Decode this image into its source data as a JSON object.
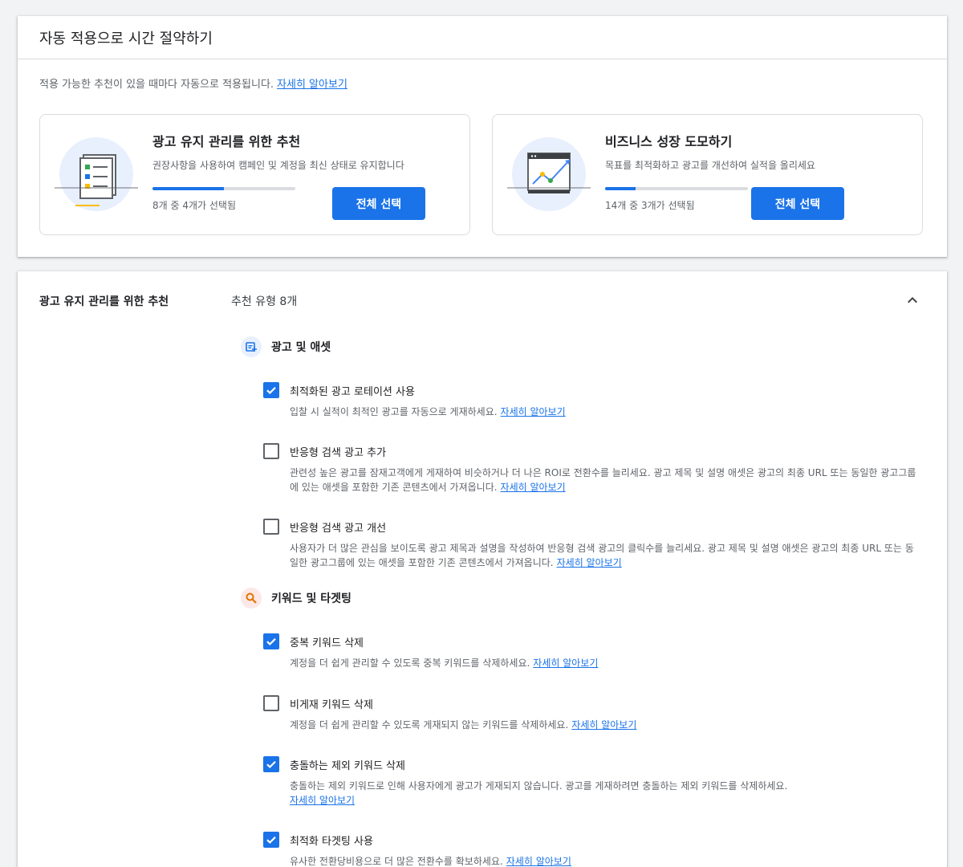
{
  "top": {
    "title": "자동 적용으로 시간 절약하기",
    "subtitle": "적용 가능한 추천이 있을 때마다 자동으로 적용됩니다.",
    "learn_more": "자세히 알아보기",
    "cards": [
      {
        "title": "광고 유지 관리를 위한 추천",
        "description": "권장사항을 사용하여 캠페인 및 계정을 최신 상태로 유지합니다",
        "progress_fraction": 0.5,
        "progress_text": "8개 중 4개가 선택됨",
        "button_label": "전체 선택",
        "icon": "checklist-illustration"
      },
      {
        "title": "비즈니스 성장 도모하기",
        "description": "목표를 최적화하고 광고를 개선하여 실적을 올리세요",
        "progress_fraction": 0.214,
        "progress_text": "14개 중 3개가 선택됨",
        "button_label": "전체 선택",
        "icon": "growth-chart-illustration"
      }
    ]
  },
  "section": {
    "title": "광고 유지 관리를 위한 추천",
    "count": "추천 유형 8개",
    "collapse_icon": "chevron-up-icon",
    "groups": [
      {
        "label": "광고 및 애셋",
        "icon": "ad-asset-icon",
        "items": [
          {
            "title": "최적화된 광고 로테이션 사용",
            "checked": true,
            "description": "입찰 시 실적이 최적인 광고를 자동으로 게재하세요.",
            "link": "자세히 알아보기"
          },
          {
            "title": "반응형 검색 광고 추가",
            "checked": false,
            "description": "관련성 높은 광고를 잠재고객에게 게재하여 비슷하거나 더 나은 ROI로 전환수를 늘리세요. 광고 제목 및 설명 애셋은 광고의 최종 URL 또는 동일한 광고그룹에 있는 애셋을 포함한 기존 콘텐츠에서 가져옵니다.",
            "link": "자세히 알아보기"
          },
          {
            "title": "반응형 검색 광고 개선",
            "checked": false,
            "description": "사용자가 더 많은 관심을 보이도록 광고 제목과 설명을 작성하여 반응형 검색 광고의 클릭수를 늘리세요. 광고 제목 및 설명 애셋은 광고의 최종 URL 또는 동일한 광고그룹에 있는 애셋을 포함한 기존 콘텐츠에서 가져옵니다.",
            "link": "자세히 알아보기"
          }
        ]
      },
      {
        "label": "키워드 및 타겟팅",
        "icon": "search-icon",
        "items": [
          {
            "title": "중복 키워드 삭제",
            "checked": true,
            "description": "계정을 더 쉽게 관리할 수 있도록 중복 키워드를 삭제하세요.",
            "link": "자세히 알아보기"
          },
          {
            "title": "비게재 키워드 삭제",
            "checked": false,
            "description": "계정을 더 쉽게 관리할 수 있도록 게재되지 않는 키워드를 삭제하세요.",
            "link": "자세히 알아보기"
          },
          {
            "title": "충돌하는 제외 키워드 삭제",
            "checked": true,
            "description": "충돌하는 제외 키워드로 인해 사용자에게 광고가 게재되지 않습니다. 광고를 게재하려면 충돌하는 제외 키워드를 삭제하세요.",
            "link": "자세히 알아보기"
          },
          {
            "title": "최적화 타겟팅 사용",
            "checked": true,
            "description": "유사한 전환당비용으로 더 많은 전환수를 확보하세요.",
            "link": "자세히 알아보기"
          }
        ]
      }
    ]
  },
  "colors": {
    "accent": "#1a73e8",
    "text_primary": "#202124",
    "text_secondary": "#5f6368",
    "border": "#dadce0"
  }
}
